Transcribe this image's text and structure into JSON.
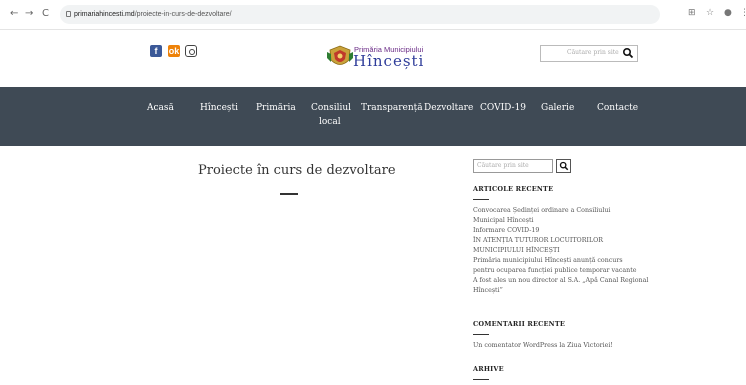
{
  "browser": {
    "back": "←",
    "forward": "→",
    "reload": "C",
    "host": "primariahincesti.md",
    "path": "/proiecte-in-curs-de-dezvoltare/"
  },
  "header": {
    "social": {
      "facebook": "f",
      "odnoklassniki": "ok"
    },
    "logo_small": "Primăria Municipiului",
    "logo_big": "Hîncești",
    "search_placeholder": "Căutare prin site"
  },
  "nav": {
    "items": [
      {
        "label": "Acasă"
      },
      {
        "label": "Hîncești"
      },
      {
        "label": "Primăria"
      },
      {
        "label": "Consiliul",
        "label2": "local"
      },
      {
        "label": "Transparență"
      },
      {
        "label": "Dezvoltare"
      },
      {
        "label": "COVID-19"
      },
      {
        "label": "Galerie"
      },
      {
        "label": "Contacte"
      }
    ]
  },
  "main": {
    "title": "Proiecte în curs de dezvoltare"
  },
  "sidebar": {
    "search_placeholder": "Căutare prin site",
    "recent_posts_title": "ARTICOLE RECENTE",
    "recent_posts": [
      "Convocarea Ședinței ordinare a Consiliului",
      "Municipal Hîncești",
      "Informare COVID-19",
      "ÎN ATENȚIA TUTUROR LOCUITORILOR",
      "MUNICIPIULUI HÎNCEȘTI",
      "Primăria municipiului Hîncești anunță concurs",
      "pentru ocuparea funcției publice temporar vacante",
      "A fost ales un nou director al S.A. „Apă Canal Regional",
      "Hîncești”"
    ],
    "recent_comments_title": "COMENTARII RECENTE",
    "recent_comment": "Un comentator WordPress la Ziua Victoriei!",
    "archives_title": "ARHIVE"
  },
  "colors": {
    "navbar": "#3f4a55",
    "facebook": "#3b5998",
    "odnoklassniki": "#ee8208",
    "logo_text": "#2f3d9a"
  }
}
